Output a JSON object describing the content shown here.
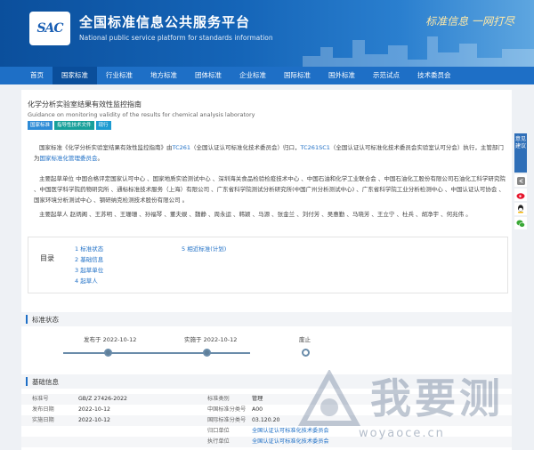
{
  "header": {
    "logo_text": "SAC",
    "title": "全国标准信息公共服务平台",
    "subtitle": "National public service platform  for standards information",
    "slogan": "标准信息 一网打尽"
  },
  "nav": [
    "首页",
    "国家标准",
    "行业标准",
    "地方标准",
    "团体标准",
    "企业标准",
    "国际标准",
    "国外标准",
    "示范试点",
    "技术委员会"
  ],
  "nav_active_index": 1,
  "doc": {
    "title": "化学分析实验室结果有效性监控指南",
    "title_en": "Guidance on monitoring validity of the results for chemical analysis laboratory",
    "badges": [
      "国家标准",
      "指导性技术文件",
      "现行"
    ]
  },
  "paragraphs": {
    "p1_a": "国家标准《化学分析实验室结果有效性监控指南》由",
    "p1_link1": "TC261",
    "p1_b": "（全国认证认可标准化技术委员会）归口，",
    "p1_link2": "TC261SC1",
    "p1_c": "（全国认证认可标准化技术委员会实验室认可分会）执行，主管部门为",
    "p1_link3": "国家标准化管理委员会",
    "p1_d": "。",
    "p2": "主要起草单位 中国合格评定国家认可中心 、国家地质实验测试中心 、深圳海关食品检验检疫技术中心 、中国石油和化学工业联合会 、中国石油化工股份有限公司石油化工科学研究院 、中国医学科学院药物研究所 、通标标准技术服务（上海）有限公司 、广东省科学院测试分析研究所(中国广州分析测试中心) 、广东省科学院工业分析检测中心 、中国认证认可协会 、国家环境分析测试中心 、钢研纳克检测技术股份有限公司 。",
    "p3": "主要起草人 赵炳阁 、王苏明 、王珊珊 、孙福琴 、董夫娱 、魏静 、周永运 、韩颖 、马源 、张金兰 、刘付芳 、吴惠勤 、马晓芳 、王立宁 、杜兵 、胡净宇 、何兆伟 。"
  },
  "toc": {
    "label": "目录",
    "col1": [
      "1  标准状态",
      "2  基础信息",
      "3  起草单位",
      "4  起草人"
    ],
    "col2": [
      "5  相近标准(计划)"
    ]
  },
  "sections": {
    "status": "标准状态",
    "info": "基础信息"
  },
  "timeline": {
    "published": "发布于 2022-10-12",
    "implemented": "实施于 2022-10-12",
    "abolished": "废止"
  },
  "info": {
    "rows": [
      {
        "k1": "标准号",
        "v1": "GB/Z 27426-2022",
        "k2": "标准类别",
        "v2": "管理"
      },
      {
        "k1": "发布日期",
        "v1": "2022-10-12",
        "k2": "中国标准分类号",
        "v2": "A00"
      },
      {
        "k1": "实施日期",
        "v1": "2022-10-12",
        "k2": "国际标准分类号",
        "v2": "03.120.20"
      },
      {
        "k1": "",
        "v1": "",
        "k2": "归口单位",
        "v2": "全国认证认可标准化技术委员会"
      },
      {
        "k1": "",
        "v1": "",
        "k2": "执行单位",
        "v2": "全国认证认可标准化技术委员会"
      }
    ]
  },
  "side": {
    "feedback": "意见建议"
  },
  "watermark": {
    "text": "我要测",
    "url": "woyaoce.cn"
  }
}
